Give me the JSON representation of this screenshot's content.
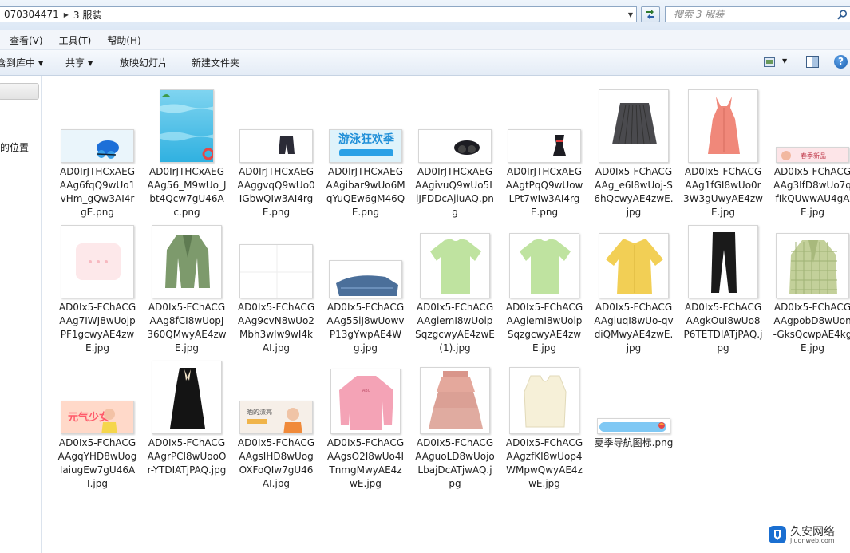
{
  "address": {
    "segments": [
      "070304471",
      "3 服装"
    ]
  },
  "search": {
    "placeholder": "搜索 3 服装"
  },
  "menu": {
    "items": [
      "查看(V)",
      "工具(T)",
      "帮助(H)"
    ]
  },
  "toolbar": {
    "include_library": "含到库中",
    "share": "共享",
    "slideshow": "放映幻灯片",
    "new_folder": "新建文件夹"
  },
  "nav": {
    "location_label": "的位置"
  },
  "files": [
    {
      "name": "AD0IrJTHCxAEGAAg6fqQ9wUo1vHm_gQw3AI4rgE.png",
      "thumb": "goggles-blue"
    },
    {
      "name": "AD0IrJTHCxAEGAAg56_M9wUo_Jbt4Qcw7gU46Ac.png",
      "thumb": "pool-poster"
    },
    {
      "name": "AD0IrJTHCxAEGAAggvqQ9wUo0IGbwQIw3AI4rgE.png",
      "thumb": "swim-trunks"
    },
    {
      "name": "AD0IrJTHCxAEGAAgibar9wUo6MqYuQEw6gM46QE.png",
      "thumb": "swim-banner",
      "banner_title": "游泳狂欢季"
    },
    {
      "name": "AD0IrJTHCxAEGAAgivuQ9wUo5LiJFDDcAjiuAQ.png",
      "thumb": "goggles-black"
    },
    {
      "name": "AD0IrJTHCxAEGAAgtPqQ9wUowLPt7wIw3AI4rgE.png",
      "thumb": "swimsuit"
    },
    {
      "name": "AD0Ix5-FChACGAAg_e6I8wUoj-S6hQcwyAE4zwE.jpg",
      "thumb": "pleated-skirt"
    },
    {
      "name": "AD0Ix5-FChACGAAg1fGI8wUo0r3W3gUwyAE4zwE.jpg",
      "thumb": "pink-dress"
    },
    {
      "name": "AD0Ix5-FChACGAAg3IfD8wUo7qfIkQUwwAU4gAE.jpg",
      "thumb": "spring-banner",
      "banner_title": "春季新品"
    },
    {
      "name": "AD0Ix5-FChACGAAg7IWJ8wUojpPF1gcwyAE4zwE.jpg",
      "thumb": "pink-square"
    },
    {
      "name": "AD0Ix5-FChACGAAg8fCI8wUopJ360QMwyAE4zwE.jpg",
      "thumb": "green-blazer"
    },
    {
      "name": "AD0Ix5-FChACGAAg9cvN8wUo2Mbh3wIw9wI4kAI.jpg",
      "thumb": "blank-grid"
    },
    {
      "name": "AD0Ix5-FChACGAAg55iJ8wUowvP13gYwpAE4Wg.jpg",
      "thumb": "jeans"
    },
    {
      "name": "AD0Ix5-FChACGAAgiemI8wUoipSqzgcwyAE4zwE (1).jpg",
      "thumb": "green-tee"
    },
    {
      "name": "AD0Ix5-FChACGAAgiemI8wUoipSqzgcwyAE4zwE.jpg",
      "thumb": "green-tee"
    },
    {
      "name": "AD0Ix5-FChACGAAgiuqI8wUo-qvdiQMwyAE4zwE.jpg",
      "thumb": "yellow-shirt"
    },
    {
      "name": "AD0Ix5-FChACGAAgkOuI8wUo8P6TETDIATjPAQ.jpg",
      "thumb": "black-pants"
    },
    {
      "name": "AD0Ix5-FChACGAAgpobD8wUon-GksQcwpAE4kgE.jpg",
      "thumb": "plaid-blazer"
    },
    {
      "name": "AD0Ix5-FChACGAAgqYHD8wUogIaiugEw7gU46AI.jpg",
      "thumb": "girl-banner",
      "banner_title": "元气少女"
    },
    {
      "name": "AD0Ix5-FChACGAAgrPCI8wUooOr-YTDIATjPAQ.jpg",
      "thumb": "black-dress"
    },
    {
      "name": "AD0Ix5-FChACGAAgsIHD8wUogOXFoQIw7gU46AI.jpg",
      "thumb": "beauty-banner",
      "banner_title": "晒的漂亮"
    },
    {
      "name": "AD0Ix5-FChACGAAgsO2I8wUo4ITnmgMwyAE4zwE.jpg",
      "thumb": "pink-sweatshirt"
    },
    {
      "name": "AD0Ix5-FChACGAAguoLD8wUojoLbajDcATjwAQ.jpg",
      "thumb": "tulle-skirt"
    },
    {
      "name": "AD0Ix5-FChACGAAgzfKI8wUop4WMpwQwyAE4zwE.jpg",
      "thumb": "knit-vest"
    },
    {
      "name": "夏季导航图标.png",
      "thumb": "nav-bar"
    }
  ],
  "watermark": {
    "title": "久安网络",
    "subtitle": "jiuonweb.com"
  }
}
